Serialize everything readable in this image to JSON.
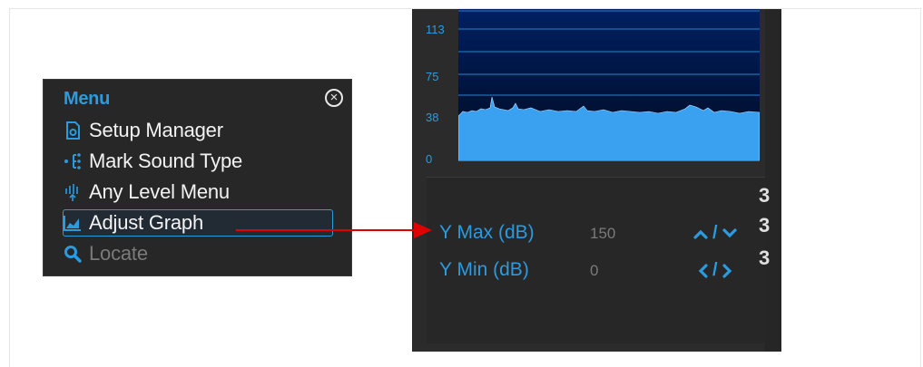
{
  "menu": {
    "title": "Menu",
    "close_icon": "close-circle-icon",
    "items": [
      {
        "label": "Setup Manager",
        "icon": "setup-manager-icon",
        "state": "normal"
      },
      {
        "label": "Mark Sound Type",
        "icon": "mark-sound-type-icon",
        "state": "normal"
      },
      {
        "label": "Any Level Menu",
        "icon": "any-level-icon",
        "state": "normal"
      },
      {
        "label": "Adjust Graph",
        "icon": "adjust-graph-icon",
        "state": "selected"
      },
      {
        "label": "Locate",
        "icon": "search-icon",
        "state": "disabled"
      }
    ]
  },
  "graph": {
    "y_ticks": [
      "113",
      "75",
      "38",
      "0"
    ]
  },
  "adjust_panel": {
    "rows": [
      {
        "label": "Y Max (dB)",
        "value": "150",
        "control": "up-down-control"
      },
      {
        "label": "Y Min (dB)",
        "value": "0",
        "control": "left-right-control"
      }
    ],
    "slash": "/",
    "edge_digits": [
      "3",
      "3",
      "3"
    ]
  },
  "colors": {
    "accent": "#2b9be0",
    "arrow": "#e00000",
    "graph_fill": "#3aa0f0",
    "graph_bg": "#001a4d"
  }
}
